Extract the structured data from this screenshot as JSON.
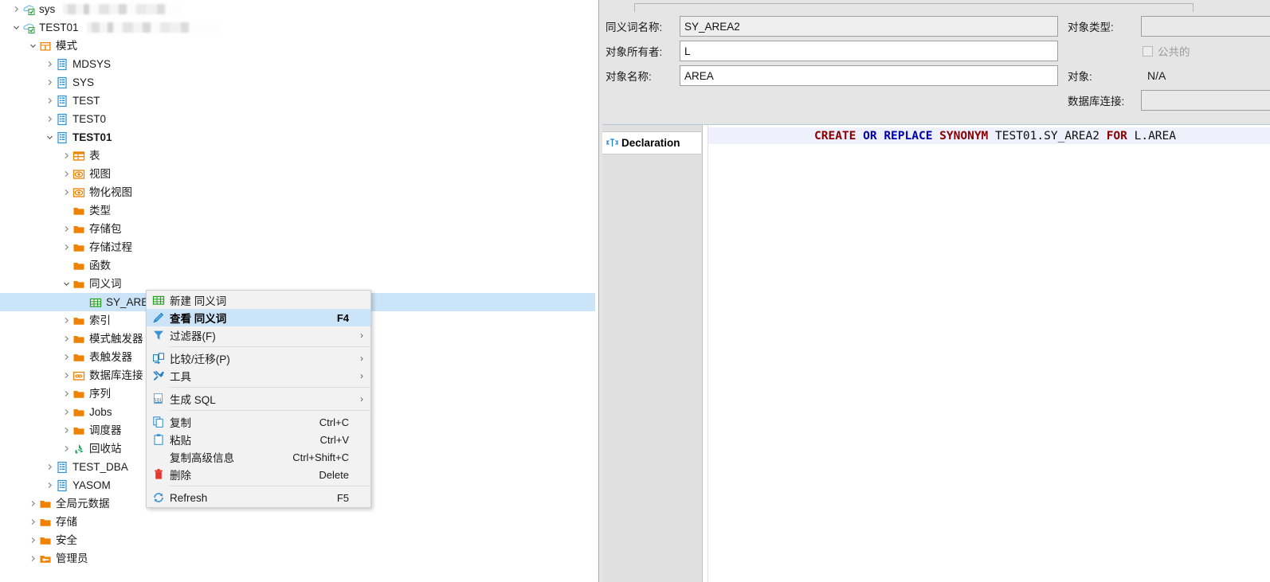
{
  "tree": {
    "items": [
      {
        "indent": 0,
        "twisty": "collapsed",
        "icon": "db-connection-icon",
        "label": "sys",
        "redacted": true,
        "redact_width": 150,
        "bold": false
      },
      {
        "indent": 0,
        "twisty": "expanded",
        "icon": "db-connection-icon",
        "label": "TEST01",
        "redacted": true,
        "redact_width": 168,
        "bold": false
      },
      {
        "indent": 1,
        "twisty": "expanded",
        "icon": "schema-folder-icon",
        "label": "模式",
        "redacted": false,
        "bold": false
      },
      {
        "indent": 2,
        "twisty": "collapsed",
        "icon": "schema-icon",
        "label": "MDSYS",
        "redacted": false,
        "bold": false
      },
      {
        "indent": 2,
        "twisty": "collapsed",
        "icon": "schema-icon",
        "label": "SYS",
        "redacted": false,
        "bold": false
      },
      {
        "indent": 2,
        "twisty": "collapsed",
        "icon": "schema-icon",
        "label": "TEST",
        "redacted": false,
        "bold": false
      },
      {
        "indent": 2,
        "twisty": "collapsed",
        "icon": "schema-icon",
        "label": "TEST0",
        "redacted": false,
        "bold": false
      },
      {
        "indent": 2,
        "twisty": "expanded",
        "icon": "schema-icon",
        "label": "TEST01",
        "redacted": false,
        "bold": true
      },
      {
        "indent": 3,
        "twisty": "collapsed",
        "icon": "table-icon",
        "label": "表",
        "redacted": false,
        "bold": false
      },
      {
        "indent": 3,
        "twisty": "collapsed",
        "icon": "view-icon",
        "label": "视图",
        "redacted": false,
        "bold": false
      },
      {
        "indent": 3,
        "twisty": "collapsed",
        "icon": "view-icon",
        "label": "物化视图",
        "redacted": false,
        "bold": false
      },
      {
        "indent": 3,
        "twisty": "none",
        "icon": "folder-icon",
        "label": "类型",
        "redacted": false,
        "bold": false
      },
      {
        "indent": 3,
        "twisty": "collapsed",
        "icon": "folder-icon",
        "label": "存储包",
        "redacted": false,
        "bold": false
      },
      {
        "indent": 3,
        "twisty": "collapsed",
        "icon": "folder-icon",
        "label": "存储过程",
        "redacted": false,
        "bold": false
      },
      {
        "indent": 3,
        "twisty": "none",
        "icon": "folder-icon",
        "label": "函数",
        "redacted": false,
        "bold": false
      },
      {
        "indent": 3,
        "twisty": "expanded",
        "icon": "folder-icon",
        "label": "同义词",
        "redacted": false,
        "bold": false
      },
      {
        "indent": 4,
        "twisty": "none",
        "icon": "synonym-icon",
        "label": "SY_AREA2",
        "redacted": false,
        "bold": false,
        "selected": true
      },
      {
        "indent": 3,
        "twisty": "collapsed",
        "icon": "folder-icon",
        "label": "索引",
        "redacted": false,
        "bold": false
      },
      {
        "indent": 3,
        "twisty": "collapsed",
        "icon": "folder-icon",
        "label": "模式触发器",
        "redacted": false,
        "bold": false
      },
      {
        "indent": 3,
        "twisty": "collapsed",
        "icon": "folder-icon",
        "label": "表触发器",
        "redacted": false,
        "bold": false
      },
      {
        "indent": 3,
        "twisty": "collapsed",
        "icon": "dblink-icon",
        "label": "数据库连接",
        "redacted": false,
        "bold": false
      },
      {
        "indent": 3,
        "twisty": "collapsed",
        "icon": "folder-icon",
        "label": "序列",
        "redacted": false,
        "bold": false
      },
      {
        "indent": 3,
        "twisty": "collapsed",
        "icon": "folder-icon",
        "label": "Jobs",
        "redacted": false,
        "bold": false
      },
      {
        "indent": 3,
        "twisty": "collapsed",
        "icon": "folder-icon",
        "label": "调度器",
        "redacted": false,
        "bold": false
      },
      {
        "indent": 3,
        "twisty": "collapsed",
        "icon": "recyclebin-icon",
        "label": "回收站",
        "redacted": false,
        "bold": false
      },
      {
        "indent": 2,
        "twisty": "collapsed",
        "icon": "schema-icon",
        "label": "TEST_DBA",
        "redacted": false,
        "bold": false
      },
      {
        "indent": 2,
        "twisty": "collapsed",
        "icon": "schema-icon",
        "label": "YASOM",
        "redacted": false,
        "bold": false
      },
      {
        "indent": 1,
        "twisty": "collapsed",
        "icon": "folder-icon",
        "label": "全局元数据",
        "redacted": false,
        "bold": false
      },
      {
        "indent": 1,
        "twisty": "collapsed",
        "icon": "folder-icon",
        "label": "存储",
        "redacted": false,
        "bold": false
      },
      {
        "indent": 1,
        "twisty": "collapsed",
        "icon": "folder-icon",
        "label": "安全",
        "redacted": false,
        "bold": false
      },
      {
        "indent": 1,
        "twisty": "collapsed",
        "icon": "admin-folder-icon",
        "label": "管理员",
        "redacted": false,
        "bold": false
      }
    ]
  },
  "context_menu": {
    "items": [
      {
        "type": "item",
        "icon": "new-synonym-icon",
        "label": "新建 同义词",
        "accel": "",
        "arrow": false,
        "highlighted": false
      },
      {
        "type": "item",
        "icon": "edit-pencil-icon",
        "label": "查看 同义词",
        "accel": "F4",
        "arrow": false,
        "highlighted": true
      },
      {
        "type": "item",
        "icon": "filter-icon",
        "label": "过滤器(F)",
        "accel": "",
        "arrow": true,
        "highlighted": false
      },
      {
        "type": "sep"
      },
      {
        "type": "item",
        "icon": "compare-migrate-icon",
        "label": "比较/迁移(P)",
        "accel": "",
        "arrow": true,
        "highlighted": false
      },
      {
        "type": "item",
        "icon": "tools-icon",
        "label": "工具",
        "accel": "",
        "arrow": true,
        "highlighted": false
      },
      {
        "type": "sep"
      },
      {
        "type": "item",
        "icon": "generate-sql-icon",
        "label": "生成 SQL",
        "accel": "",
        "arrow": true,
        "highlighted": false
      },
      {
        "type": "sep"
      },
      {
        "type": "item",
        "icon": "copy-icon",
        "label": "复制",
        "accel": "Ctrl+C",
        "arrow": false,
        "highlighted": false
      },
      {
        "type": "item",
        "icon": "paste-icon",
        "label": "粘贴",
        "accel": "Ctrl+V",
        "arrow": false,
        "highlighted": false
      },
      {
        "type": "item",
        "icon": "none",
        "label": "复制高级信息",
        "accel": "Ctrl+Shift+C",
        "arrow": false,
        "highlighted": false
      },
      {
        "type": "item",
        "icon": "delete-trash-icon",
        "label": "删除",
        "accel": "Delete",
        "arrow": false,
        "highlighted": false
      },
      {
        "type": "sep"
      },
      {
        "type": "item",
        "icon": "refresh-icon",
        "label": "Refresh",
        "accel": "F5",
        "arrow": false,
        "highlighted": false
      }
    ]
  },
  "form": {
    "synonym_name_label": "同义词名称:",
    "synonym_name_value": "SY_AREA2",
    "object_owner_label": "对象所有者:",
    "object_owner_value": "L",
    "object_name_label": "对象名称:",
    "object_name_value": "AREA",
    "object_type_label": "对象类型:",
    "object_type_value": "",
    "public_checkbox_label": "公共的",
    "public_checked": false,
    "object_label": "对象:",
    "object_value": "N/A",
    "db_link_label": "数据库连接:",
    "db_link_value": ""
  },
  "editor": {
    "side_tab_label": "Declaration",
    "sql": {
      "tokens": [
        {
          "t": "CREATE",
          "c": "red"
        },
        {
          "t": " ",
          "c": "plain"
        },
        {
          "t": "OR",
          "c": "blue"
        },
        {
          "t": " ",
          "c": "plain"
        },
        {
          "t": "REPLACE",
          "c": "blue"
        },
        {
          "t": " ",
          "c": "plain"
        },
        {
          "t": "SYNONYM",
          "c": "red"
        },
        {
          "t": " TEST01.SY_AREA2 ",
          "c": "plain"
        },
        {
          "t": "FOR",
          "c": "red"
        },
        {
          "t": " L.AREA",
          "c": "plain"
        }
      ],
      "full_text": "CREATE OR REPLACE SYNONYM TEST01.SY_AREA2 FOR L.AREA"
    }
  },
  "colors": {
    "selection": "#cce4f7",
    "keyword_red": "#8b0000",
    "keyword_blue": "#0000b0",
    "panel_bg": "#e5e5e5",
    "folder_orange": "#ef8200"
  }
}
